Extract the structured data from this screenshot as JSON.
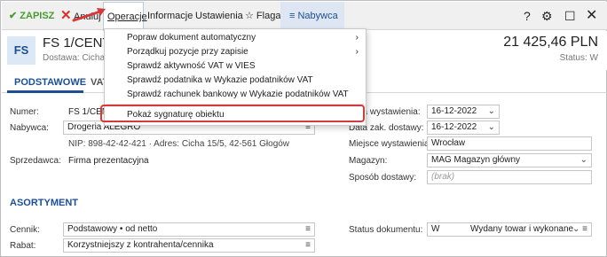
{
  "toolbar": {
    "save_label": "ZAPISZ",
    "close_label": "Anuluj",
    "operacje_label": "Operacje",
    "informacje_label": "Informacje",
    "ustawienia_label": "Ustawienia",
    "flaga_label": "Flaga",
    "nabywca_label": "Nabywca",
    "help_label": "?"
  },
  "document": {
    "badge": "FS",
    "title": "FS 1/CENTRALA",
    "subtitle": "Dostawa: Cicha",
    "amount": "21 425,46 PLN",
    "status": "Status: W"
  },
  "tabs": [
    "PODSTAWOWE",
    "VAT"
  ],
  "menu": {
    "items": [
      {
        "label": "Popraw dokument automatyczny",
        "submenu": true
      },
      {
        "label": "Porządkuj pozycje przy zapisie",
        "submenu": true
      },
      {
        "label": "Sprawdź aktywność VAT w VIES",
        "submenu": false
      },
      {
        "label": "Sprawdź podatnika w Wykazie podatników VAT",
        "submenu": false
      },
      {
        "label": "Sprawdź rachunek bankowy w Wykazie podatników VAT",
        "submenu": false
      },
      {
        "label": "Pokaż sygnaturę obiektu",
        "submenu": false
      }
    ]
  },
  "form": {
    "numer_label": "Numer:",
    "numer_value": "FS 1/CEN",
    "nabywca_label": "Nabywca:",
    "nabywca_value": "Drogeria ALEGRO",
    "nabywca_details": "NIP: 898-42-42-421  ·  Adres: Cicha 15/5, 42-561 Głogów",
    "sprzedawca_label": "Sprzedawca:",
    "sprzedawca_value": "Firma prezentacyjna",
    "data_wyst_label": "Data wystawienia:",
    "data_wyst_value": "16-12-2022",
    "data_dost_label": "Data zak. dostawy:",
    "data_dost_value": "16-12-2022",
    "miejsce_label": "Miejsce wystawienia:",
    "miejsce_value": "Wrocław",
    "magazyn_label": "Magazyn:",
    "magazyn_value": "MAG  Magazyn główny",
    "sposob_label": "Sposób dostawy:",
    "sposob_placeholder": "(brak)"
  },
  "asortyment": {
    "section_label": "ASORTYMENT",
    "cennik_label": "Cennik:",
    "cennik_value": "Podstawowy • od netto",
    "rabat_label": "Rabat:",
    "rabat_value": "Korzystniejszy z kontrahenta/cennika",
    "status_label": "Status dokumentu:",
    "status_code": "W",
    "status_value": "Wydany towar i wykonane"
  },
  "colors": {
    "accent": "#1e4f8f",
    "save_green": "#4a9a2f",
    "highlight_red": "#d43a3a"
  }
}
